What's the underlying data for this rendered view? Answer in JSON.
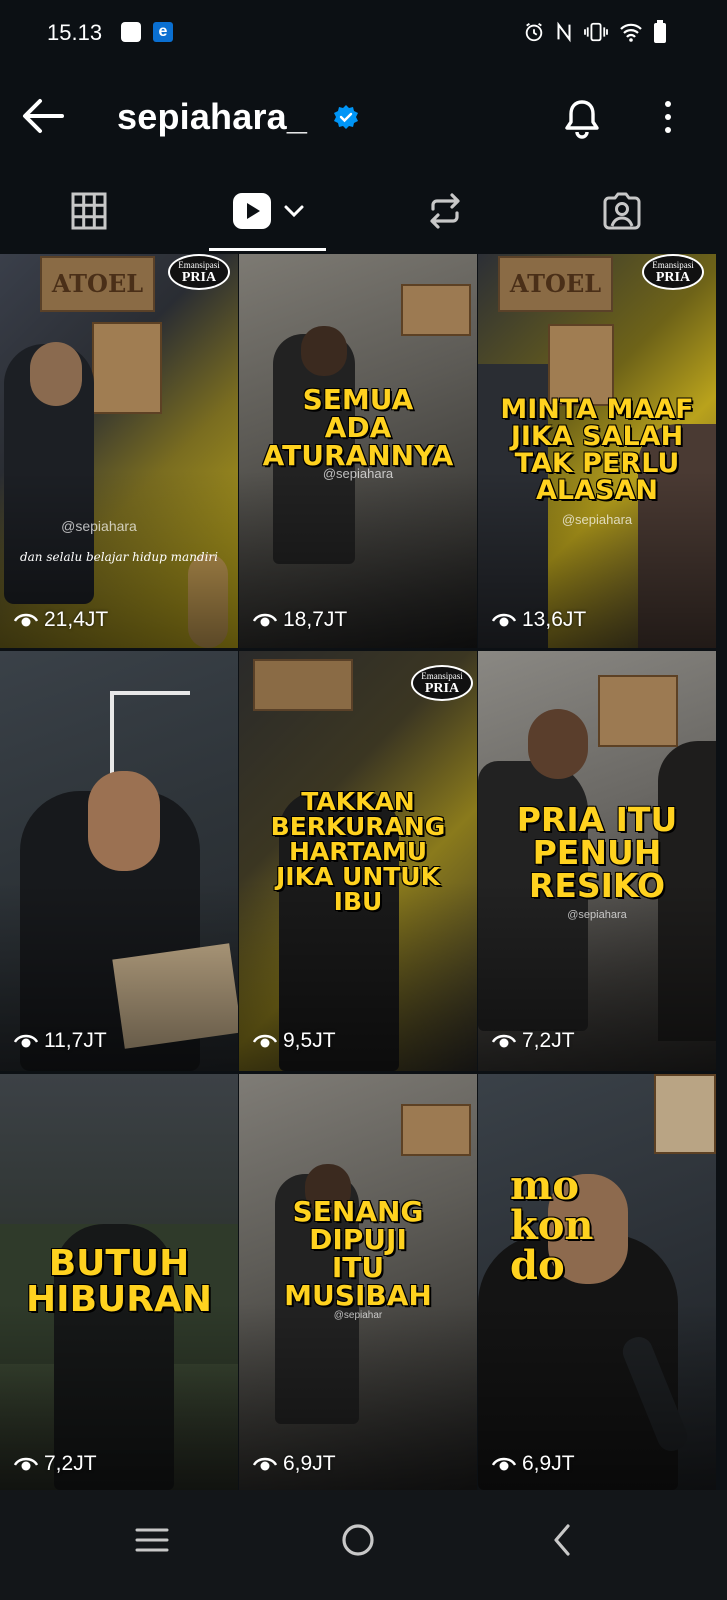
{
  "status_bar": {
    "time": "15.13",
    "icons": [
      "app-notification-icon",
      "edge-browser-icon",
      "alarm-icon",
      "nfc-icon",
      "vibrate-icon",
      "wifi-icon",
      "battery-icon"
    ]
  },
  "header": {
    "username": "sepiahara_",
    "verified": true,
    "icons": [
      "back-arrow-icon",
      "verified-badge-icon",
      "bell-icon",
      "more-vertical-icon"
    ]
  },
  "tabs": [
    {
      "name": "grid",
      "icon": "grid-icon",
      "active": false
    },
    {
      "name": "reels",
      "icon": "reels-play-icon",
      "active": true
    },
    {
      "name": "reposts",
      "icon": "repost-icon",
      "active": false
    },
    {
      "name": "tagged",
      "icon": "tagged-person-icon",
      "active": false
    }
  ],
  "tiles": [
    {
      "views": "21,4JT",
      "overlay": [],
      "handle": "@sepiahara",
      "caption": "dan selalu belajar hidup mandiri",
      "sign": "ATOEL",
      "badge": true
    },
    {
      "views": "18,7JT",
      "overlay": [
        "SEMUA",
        "ADA",
        "ATURANNYA"
      ],
      "handle": "@sepiahara",
      "caption": "",
      "sign": "",
      "badge": false
    },
    {
      "views": "13,6JT",
      "overlay": [
        "MINTA MAAF",
        "JIKA SALAH",
        "TAK PERLU",
        "ALASAN"
      ],
      "handle": "@sepiahara",
      "caption": "",
      "sign": "ATOEL",
      "badge": true
    },
    {
      "views": "11,7JT",
      "overlay": [],
      "handle": "",
      "caption": "",
      "sign": "",
      "badge": false
    },
    {
      "views": "9,5JT",
      "overlay": [
        "TAKKAN",
        "BERKURANG",
        "HARTAMU",
        "JIKA UNTUK",
        "IBU"
      ],
      "handle": "",
      "caption": "",
      "sign": "",
      "badge": true
    },
    {
      "views": "7,2JT",
      "overlay": [
        "PRIA ITU",
        "PENUH",
        "RESIKO"
      ],
      "handle": "@sepiahara",
      "caption": "",
      "sign": "",
      "badge": false
    },
    {
      "views": "7,2JT",
      "overlay": [
        "BUTUH",
        "HIBURAN"
      ],
      "handle": "",
      "caption": "",
      "sign": "",
      "badge": false
    },
    {
      "views": "6,9JT",
      "overlay": [
        "SENANG",
        "DIPUJI",
        "ITU",
        "MUSIBAH"
      ],
      "handle": "@sepiahar",
      "caption": "",
      "sign": "",
      "badge": false
    },
    {
      "views": "6,9JT",
      "overlay": [
        "mo",
        "kon",
        "do"
      ],
      "handle": "",
      "caption": "",
      "sign": "",
      "badge": false
    }
  ],
  "badge_text": {
    "line1": "Emansipasi",
    "line2": "PRIA"
  },
  "nav": [
    "recents-icon",
    "home-icon",
    "back-icon"
  ]
}
